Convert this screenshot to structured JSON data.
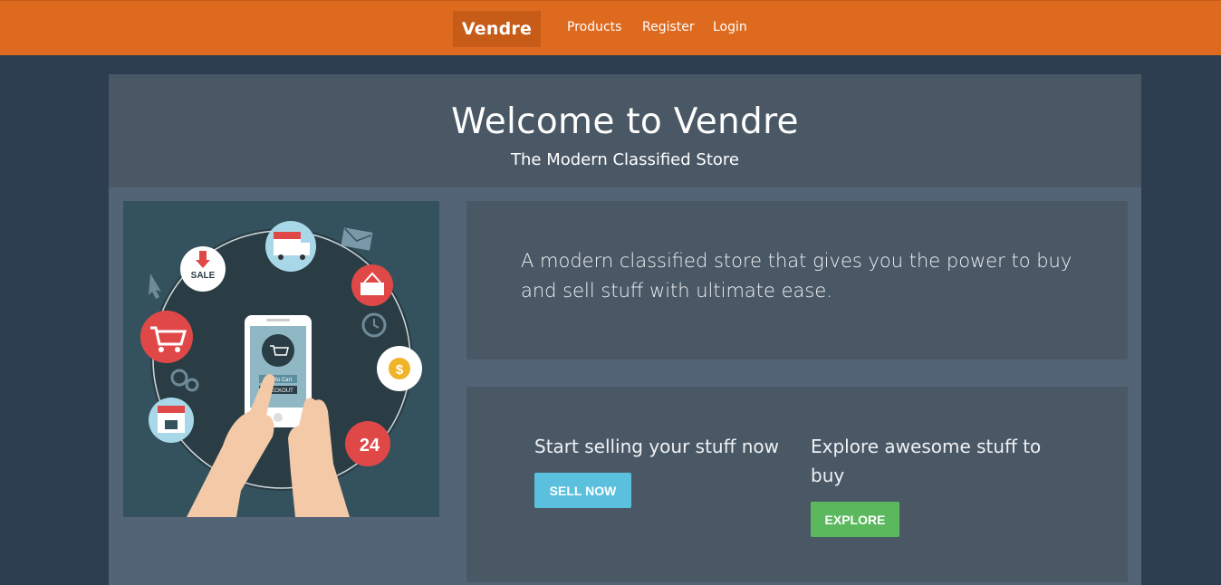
{
  "navbar": {
    "brand": "Vendre",
    "links": [
      "Products",
      "Register",
      "Login"
    ]
  },
  "hero": {
    "title": "Welcome to Vendre",
    "subtitle": "The Modern Classified Store"
  },
  "illustration": {
    "sale_label": "SALE",
    "number_badge": "24",
    "phone_button_1": "Add to Cart",
    "phone_button_2": "CHECKOUT"
  },
  "intro": {
    "text": "A modern classified store that gives you the power to buy and sell stuff with ultimate ease."
  },
  "sell": {
    "text": "Start selling your stuff now",
    "button": "SELL NOW"
  },
  "explore": {
    "text": "Explore awesome stuff to buy",
    "button": "EXPLORE"
  },
  "colors": {
    "navbar": "#dd6a1f",
    "background": "#2c3e50",
    "sell_button": "#5bc0de",
    "explore_button": "#5cb85c"
  }
}
